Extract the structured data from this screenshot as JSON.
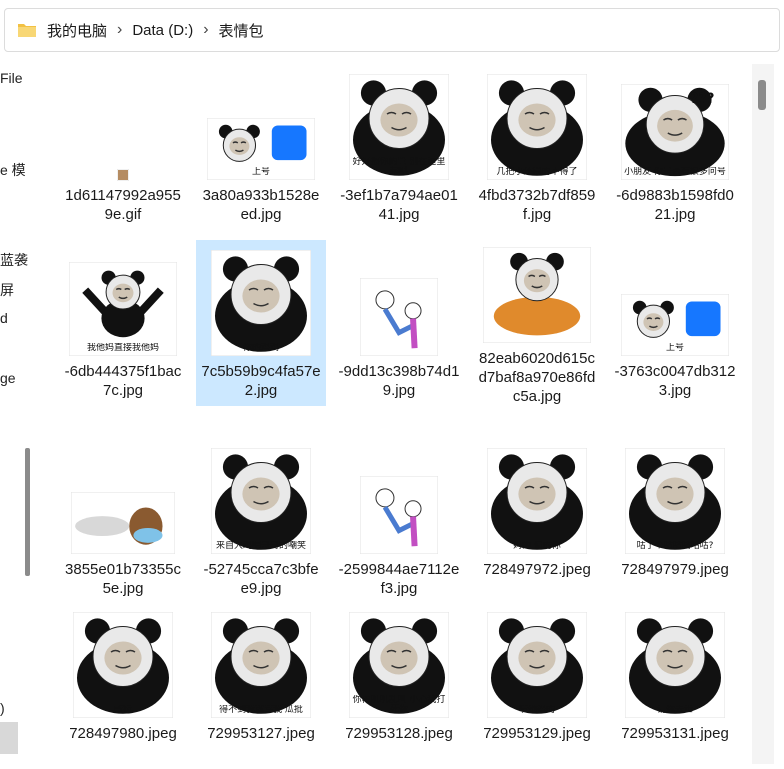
{
  "breadcrumb": [
    "我的电脑",
    "Data (D:)",
    "表情包"
  ],
  "nav_pane_labels": [
    "File",
    "e 模",
    "蓝袭",
    "屏",
    "d",
    "ge",
    ")"
  ],
  "colors": {
    "selection": "#cce8ff",
    "folder": "#f2c143"
  },
  "files": [
    {
      "name": "1d61147992a9559e.gif",
      "caption": "",
      "thumb": "small-gif"
    },
    {
      "name": "3a80a933b1528eed.jpg",
      "caption": "上号",
      "thumb": "panda-app-logo"
    },
    {
      "name": "-3ef1b7a794ae0141.jpg",
      "caption": "好好擦你的管 别在这里起哄",
      "thumb": "panda"
    },
    {
      "name": "4fbd3732b7df859f.jpg",
      "caption": "几把小还拽的不得了",
      "thumb": "panda"
    },
    {
      "name": "-6d9883b1598fd021.jpg",
      "caption": "小朋友 你是否有很多问号",
      "thumb": "panda-question"
    },
    {
      "name": "-6db444375f1bac7c.jpg",
      "caption": "我他妈直接我他妈",
      "thumb": "panda-dancing"
    },
    {
      "name": "7c5b59b9c4fa57e2.jpg",
      "caption": "你的鸡鸡",
      "thumb": "panda"
    },
    {
      "name": "-9dd13c398b74d19.jpg",
      "caption": "",
      "thumb": "cartoon-kick"
    },
    {
      "name": "82eab6020d615cd7baf8a970e86fdc5a.jpg",
      "caption": "",
      "thumb": "panda-tiger"
    },
    {
      "name": "-3763c0047db3123.jpg",
      "caption": "上号",
      "thumb": "panda-app-logo"
    },
    {
      "name": "3855e01b73355c5e.jpg",
      "caption": "",
      "thumb": "horse"
    },
    {
      "name": "-52745cca7c3bfee9.jpg",
      "caption": "来自大鸡吧哥哥的嘲笑",
      "thumb": "panda"
    },
    {
      "name": "-2599844ae7112ef3.jpg",
      "caption": "",
      "thumb": "cartoon-kick"
    },
    {
      "name": "728497972.jpeg",
      "caption": "妈的 惯的你",
      "thumb": "panda"
    },
    {
      "name": "728497979.jpeg",
      "caption": "咕了个咕咕咕咕咕?",
      "thumb": "panda"
    },
    {
      "name": "728497980.jpeg",
      "caption": "敷衍",
      "thumb": "panda"
    },
    {
      "name": "729953127.jpeg",
      "caption": "得不到我就骂我 瓜批",
      "thumb": "panda"
    },
    {
      "name": "729953128.jpeg",
      "caption": "你再叽叽乱叫 小心我打死你",
      "thumb": "panda"
    },
    {
      "name": "729953129.jpeg",
      "caption": "咦他妈的",
      "thumb": "panda"
    },
    {
      "name": "729953131.jpeg",
      "caption": "请你去世",
      "thumb": "panda"
    }
  ],
  "selected_index": 6
}
